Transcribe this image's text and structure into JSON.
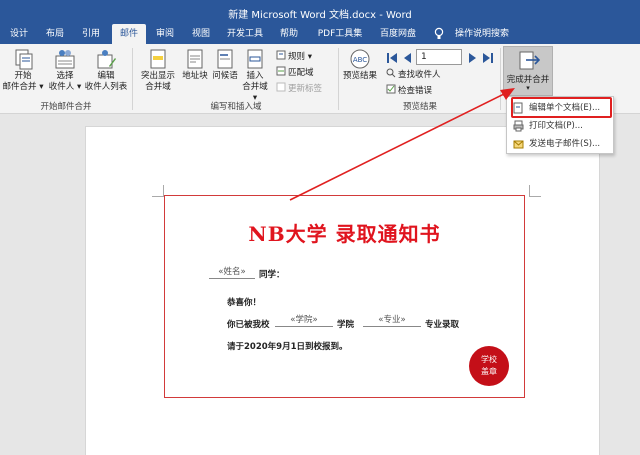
{
  "window": {
    "title": "新建 Microsoft Word 文档.docx - Word"
  },
  "tabs": [
    {
      "label": "设计"
    },
    {
      "label": "布局"
    },
    {
      "label": "引用"
    },
    {
      "label": "邮件"
    },
    {
      "label": "审阅"
    },
    {
      "label": "视图"
    },
    {
      "label": "开发工具"
    },
    {
      "label": "帮助"
    },
    {
      "label": "PDF工具集"
    },
    {
      "label": "百度网盘"
    },
    {
      "label": "操作说明搜索"
    }
  ],
  "ribbon": {
    "start": {
      "label": "开始\n邮件合并",
      "line1": "开始",
      "line2": "邮件合并 ▾"
    },
    "select": {
      "line1": "选择",
      "line2": "收件人 ▾"
    },
    "edit": {
      "line1": "编辑",
      "line2": "收件人列表"
    },
    "group1_label": "开始邮件合并",
    "highlight": {
      "line1": "突出显示",
      "line2": "合并域"
    },
    "address": {
      "label": "地址块"
    },
    "greeting": {
      "label": "问候语"
    },
    "insert": {
      "line1": "插入",
      "line2": "合并域 ▾"
    },
    "rules": {
      "label": "规则 ▾"
    },
    "match": {
      "label": "匹配域"
    },
    "update": {
      "label": "更新标签"
    },
    "group2_label": "编写和插入域",
    "preview": {
      "label": "预览结果"
    },
    "record_value": "1",
    "find": {
      "label": "查找收件人"
    },
    "check": {
      "label": "检查错误"
    },
    "group3_label": "预览结果",
    "finish": {
      "line1": "完成并合并",
      "line2": "▾"
    }
  },
  "menu": {
    "items": [
      {
        "label": "编辑单个文档(E)..."
      },
      {
        "label": "打印文档(P)..."
      },
      {
        "label": "发送电子邮件(S)..."
      }
    ]
  },
  "letter": {
    "title": "NB大学 录取通知书",
    "name_field": "«姓名»",
    "classmate": "同学：",
    "congrats": "恭喜你！",
    "admitted": "你已被我校",
    "college_field": "«学院»",
    "college": "学院",
    "major_field": "«专业»",
    "major": "专业录取",
    "report": "请于2020年9月1日到校报到。",
    "seal_line1": "学校",
    "seal_line2": "盖章"
  },
  "colors": {
    "brand": "#2b579a",
    "accent_red": "#e0141e",
    "seal": "#c40f18"
  }
}
